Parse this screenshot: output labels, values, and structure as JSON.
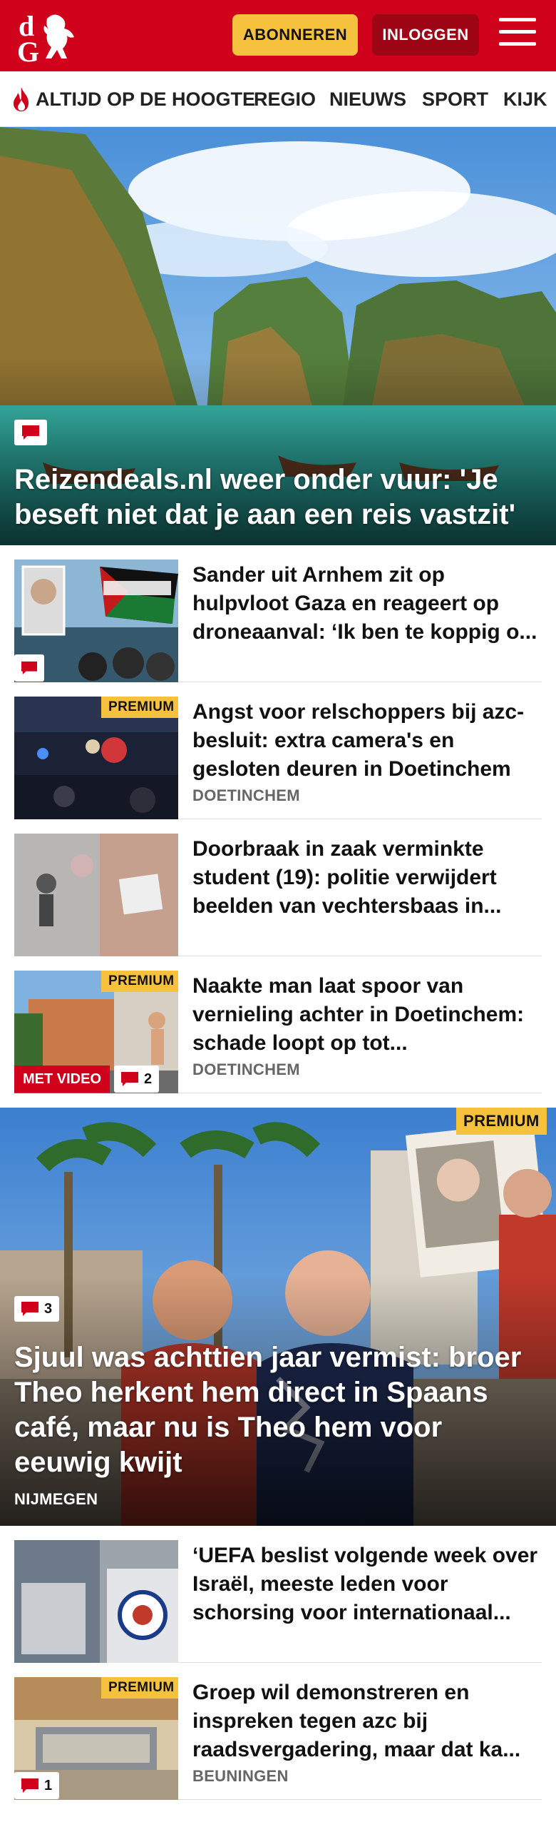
{
  "header": {
    "subscribe_label": "ABONNEREN",
    "login_label": "INLOGGEN",
    "brand_color": "#d0021b",
    "logo_letters": "dG"
  },
  "nav": {
    "items": [
      "ALTIJD OP DE HOOGTE",
      "REGIO",
      "NIEUWS",
      "SPORT",
      "KIJK"
    ]
  },
  "hero1": {
    "title": "Reizendeals.nl weer onder vuur: 'Je beseft niet dat je aan een reis vastzit'"
  },
  "articles_top": [
    {
      "title": "Sander uit Arnhem zit op hulpvloot Gaza en reageert op droneaanval: ‘Ik ben te koppig o...",
      "location": "",
      "premium": false,
      "comments": ""
    },
    {
      "title": "Angst voor relschoppers bij azc-besluit: extra camera's en gesloten deuren in Doetinchem",
      "location": "DOETINCHEM",
      "premium": true,
      "premium_label": "PREMIUM"
    },
    {
      "title": "Doorbraak in zaak verminkte student (19): politie verwijdert beelden van vechtersbaas in...",
      "location": ""
    },
    {
      "title": "Naakte man laat spoor van vernieling achter in Doetinchem: schade loopt op tot...",
      "location": "DOETINCHEM",
      "premium_label": "PREMIUM",
      "video_label": "MET VIDEO",
      "comments": "2"
    }
  ],
  "hero2": {
    "title": "Sjuul was achttien jaar vermist: broer Theo herkent hem direct in Spaans café, maar nu is Theo hem voor eeuwig kwijt",
    "location": "NIJMEGEN",
    "premium_label": "PREMIUM",
    "comments": "3"
  },
  "articles_bottom": [
    {
      "title": "‘UEFA beslist volgende week over Israël, meeste leden voor schorsing voor internationaal...",
      "location": ""
    },
    {
      "title": "Groep wil demonstreren en inspreken tegen azc bij raadsvergadering, maar dat ka...",
      "location": "BEUNINGEN",
      "premium_label": "PREMIUM",
      "comments": "1"
    }
  ]
}
